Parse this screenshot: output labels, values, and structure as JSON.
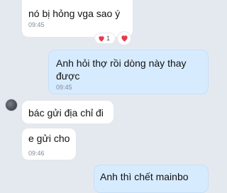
{
  "messages": [
    {
      "text": "nó bị hỏng vga sao ý",
      "time": "09:45"
    },
    {
      "text": "Anh hỏi thợ rồi dòng này thay được",
      "time": "09:45"
    },
    {
      "text": "bác gửi địa chỉ đi"
    },
    {
      "text": "e gửi cho",
      "time": "09:46"
    },
    {
      "text": "Anh thì chết mainbo"
    }
  ],
  "reaction": {
    "count": "1",
    "icon": "heart-icon"
  },
  "colors": {
    "background": "#e4e9f0",
    "incoming": "#ffffff",
    "outgoing": "#d7ebff",
    "heart": "#e53950"
  }
}
